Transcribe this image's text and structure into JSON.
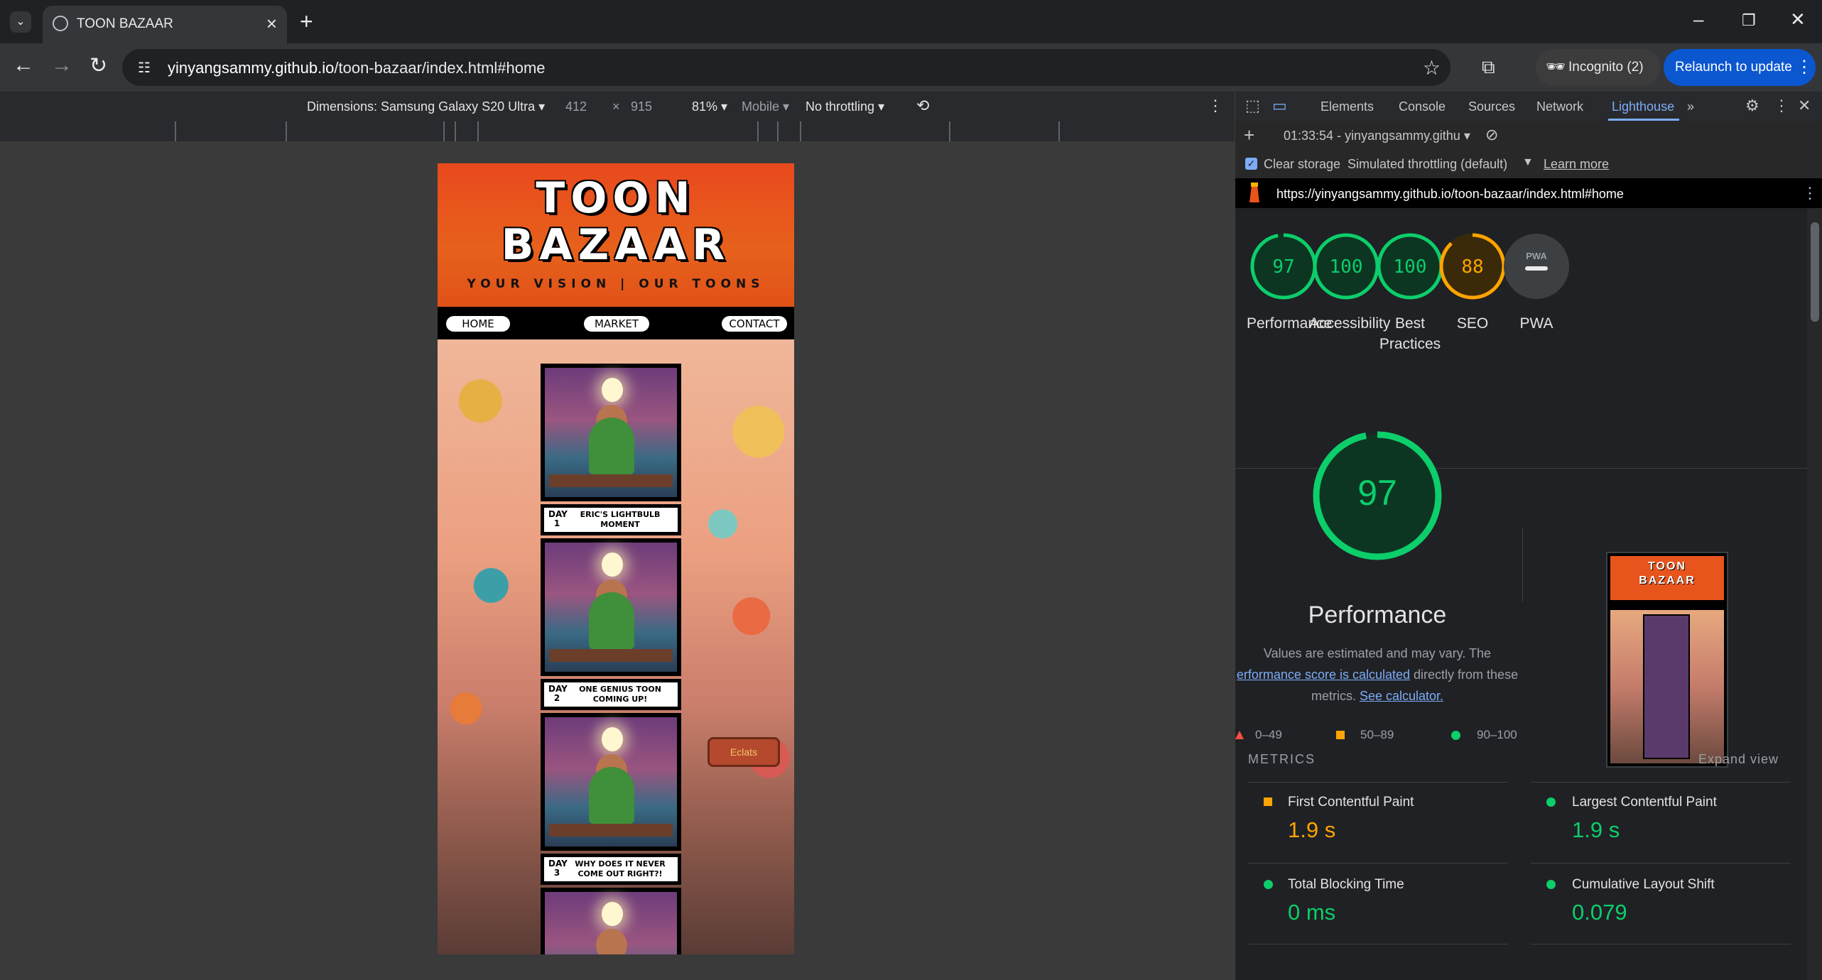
{
  "browser": {
    "tab_title": "TOON BAZAAR",
    "url_host": "yinyangsammy.github.io",
    "url_path": "/toon-bazaar/index.html#home",
    "incognito_label": "Incognito (2)",
    "relaunch_label": "Relaunch to update"
  },
  "device_toolbar": {
    "dimensions_label": "Dimensions: Samsung Galaxy S20 Ultra",
    "width": "412",
    "times": "×",
    "height": "915",
    "zoom": "81%",
    "device_type": "Mobile",
    "throttling": "No throttling"
  },
  "site": {
    "title_line1": "TOON",
    "title_line2": "BAZAAR",
    "tagline": "YOUR VISION | OUR TOONS",
    "nav": [
      "HOME",
      "MARKET",
      "CONTACT"
    ],
    "captions": [
      {
        "day": "DAY 1",
        "text": "ERIC'S LIGHTBULB MOMENT"
      },
      {
        "day": "DAY 2",
        "text": "ONE GENIUS TOON COMING UP!"
      },
      {
        "day": "DAY 3",
        "text": "WHY DOES IT NEVER COME OUT RIGHT?!"
      }
    ],
    "sign_text": "Eclats"
  },
  "devtools": {
    "tabs": [
      "Elements",
      "Console",
      "Sources",
      "Network",
      "Lighthouse"
    ],
    "active_tab": "Lighthouse",
    "report_select": "01:33:54 - yinyangsammy.githu",
    "clear_storage_label": "Clear storage",
    "throttling_label": "Simulated throttling (default)",
    "learn_more": "Learn more",
    "report_url": "https://yinyangsammy.github.io/toon-bazaar/index.html#home"
  },
  "lighthouse": {
    "scores": [
      {
        "name": "Performance",
        "value": 97,
        "color": "#0cce6b"
      },
      {
        "name": "Accessibility",
        "value": 100,
        "color": "#0cce6b"
      },
      {
        "name": "Best Practices",
        "value": 100,
        "color": "#0cce6b"
      },
      {
        "name": "SEO",
        "value": 88,
        "color": "#ffa400"
      },
      {
        "name": "PWA",
        "value": "—",
        "color": "#9aa0a6"
      }
    ],
    "pwa_badge": "PWA",
    "main_score": "97",
    "main_title": "Performance",
    "desc_line1": "Values are estimated and may vary. The",
    "desc_link1": "erformance score is calculated",
    "desc_mid": "directly from these",
    "desc_line3a": "metrics.",
    "desc_link2": "See calculator.",
    "legend": [
      "0–49",
      "50–89",
      "90–100"
    ],
    "metrics_heading": "METRICS",
    "expand_view": "Expand view",
    "metrics": [
      {
        "name": "First Contentful Paint",
        "value": "1.9 s",
        "status": "average"
      },
      {
        "name": "Largest Contentful Paint",
        "value": "1.9 s",
        "status": "pass"
      },
      {
        "name": "Total Blocking Time",
        "value": "0 ms",
        "status": "pass"
      },
      {
        "name": "Cumulative Layout Shift",
        "value": "0.079",
        "status": "pass"
      }
    ],
    "thumb_title1": "TOON",
    "thumb_title2": "BAZAAR"
  },
  "colors": {
    "pass": "#0cce6b",
    "average": "#ffa400",
    "fail": "#ff4e42",
    "accent_blue": "#7cacf8"
  }
}
